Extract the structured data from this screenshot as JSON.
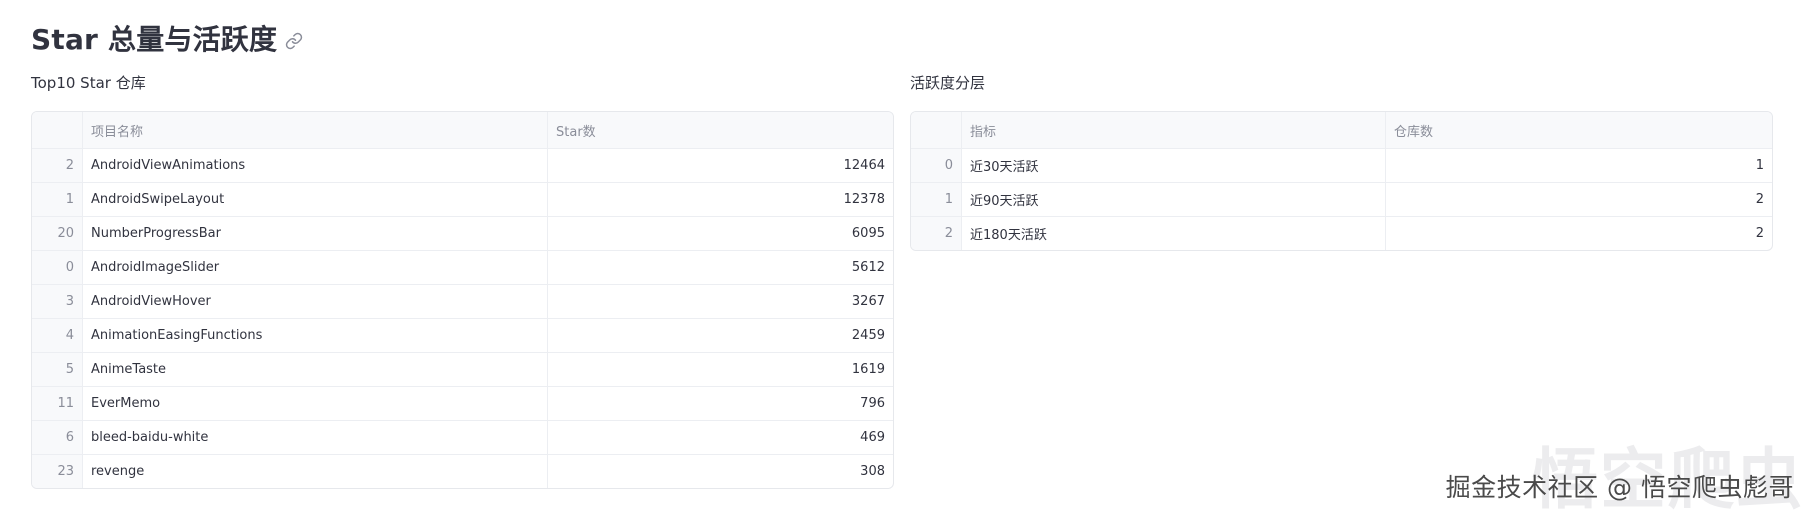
{
  "header": {
    "title": "Star 总量与活跃度",
    "anchor_icon": "link-icon"
  },
  "left_table": {
    "caption": "Top10 Star 仓库",
    "columns": [
      "",
      "项目名称",
      "Star数"
    ],
    "rows": [
      {
        "index": "2",
        "name": "AndroidViewAnimations",
        "value": "12464"
      },
      {
        "index": "1",
        "name": "AndroidSwipeLayout",
        "value": "12378"
      },
      {
        "index": "20",
        "name": "NumberProgressBar",
        "value": "6095"
      },
      {
        "index": "0",
        "name": "AndroidImageSlider",
        "value": "5612"
      },
      {
        "index": "3",
        "name": "AndroidViewHover",
        "value": "3267"
      },
      {
        "index": "4",
        "name": "AnimationEasingFunctions",
        "value": "2459"
      },
      {
        "index": "5",
        "name": "AnimeTaste",
        "value": "1619"
      },
      {
        "index": "11",
        "name": "EverMemo",
        "value": "796"
      },
      {
        "index": "6",
        "name": "bleed-baidu-white",
        "value": "469"
      },
      {
        "index": "23",
        "name": "revenge",
        "value": "308"
      }
    ]
  },
  "right_table": {
    "caption": "活跃度分层",
    "columns": [
      "",
      "指标",
      "仓库数"
    ],
    "rows": [
      {
        "index": "0",
        "name": "近30天活跃",
        "value": "1"
      },
      {
        "index": "1",
        "name": "近90天活跃",
        "value": "2"
      },
      {
        "index": "2",
        "name": "近180天活跃",
        "value": "2"
      }
    ]
  },
  "watermark": {
    "text": "掘金技术社区 @ 悟空爬虫彪哥",
    "background_text": "悟空爬虫"
  },
  "colors": {
    "text": "#31333f",
    "muted": "#8a8d99",
    "border": "#e6e8ec",
    "header_bg": "#f8f9fb"
  }
}
